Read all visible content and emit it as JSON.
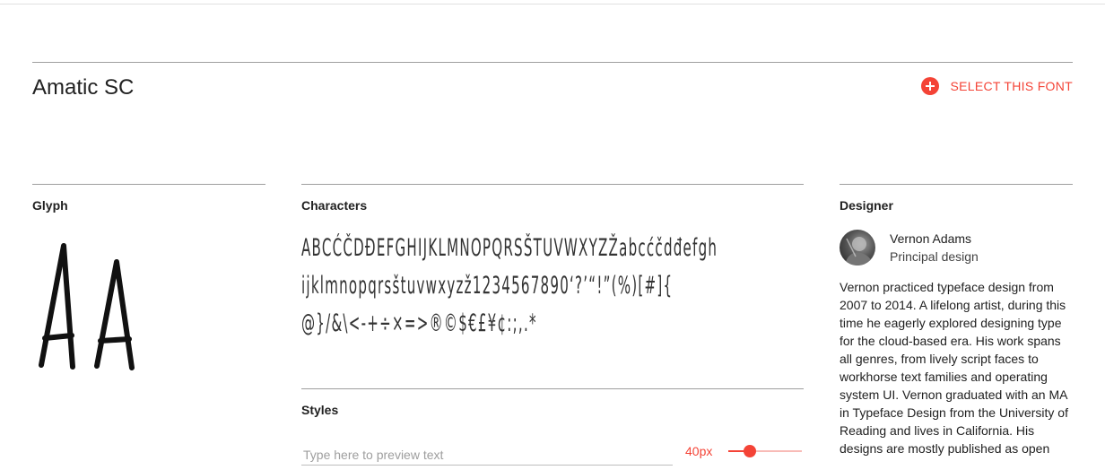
{
  "font": {
    "name": "Amatic SC"
  },
  "select_button": {
    "label": "SELECT THIS FONT",
    "icon": "add-circle-icon",
    "color": "#f44336"
  },
  "glyph": {
    "title": "Glyph",
    "sample": "Aa"
  },
  "characters": {
    "title": "Characters",
    "lines": [
      "ABCĆČDĐEFGHIJKLMNOPQRSŠTUVWXYZŽabcćčdđefgh",
      "ijklmnopqrsštuvwxyzž1234567890‘?’“!”(%)[#]{",
      "@}/&\\<-+÷×=>®©$€£¥¢:;,.*"
    ]
  },
  "styles": {
    "title": "Styles",
    "preview_placeholder": "Type here to preview text",
    "size_label": "40px",
    "size_value": 40
  },
  "designer": {
    "title": "Designer",
    "name": "Vernon Adams",
    "role": "Principal design",
    "bio": "Vernon practiced typeface design from 2007 to 2014. A lifelong artist, during this time he eagerly explored designing type for the cloud-based era. His work spans all genres, from lively script faces to workhorse text families and operating system UI. Vernon graduated with an MA in Typeface Design from the University of Reading and lives in California. His designs are mostly published as open"
  },
  "accent_color": "#f44336"
}
